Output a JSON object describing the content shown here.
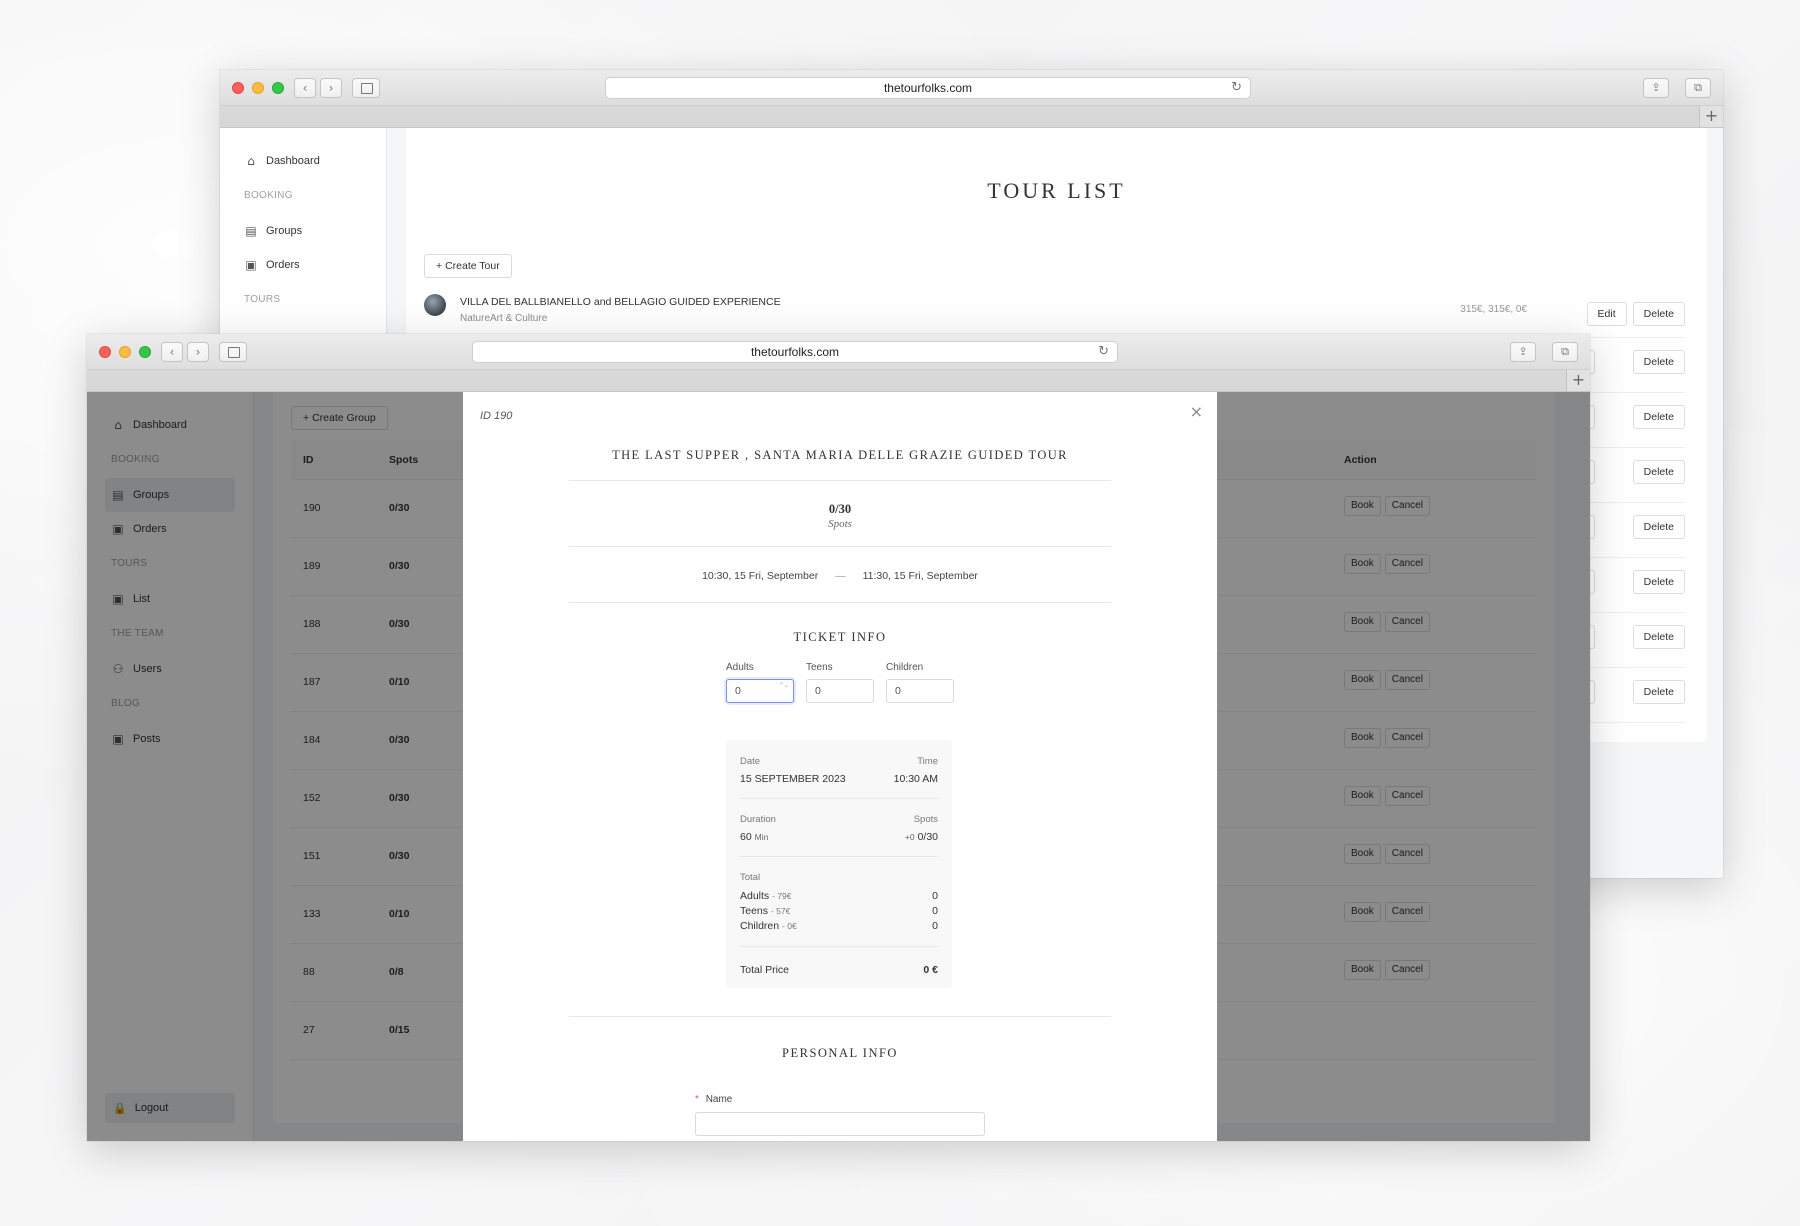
{
  "url": "thetourfolks.com",
  "icons": {
    "dashboard": "⌂",
    "groups": "▤",
    "orders": "▣",
    "list": "▣",
    "users": "⚇",
    "posts": "▣",
    "logout": "🔒",
    "plus": "+",
    "close": "×",
    "reload": "↻",
    "back": "‹",
    "forward": "›",
    "share": "⇪",
    "tabs": "⧉"
  },
  "back_window": {
    "sidebar": {
      "dashboard": "Dashboard",
      "booking_head": "BOOKING",
      "groups": "Groups",
      "orders": "Orders",
      "tours_head": "TOURS"
    },
    "title": "TOUR LIST",
    "create_tour": "Create Tour",
    "tour": {
      "name": "VILLA DEL BALLBIANELLO and BELLAGIO GUIDED EXPERIENCE",
      "category": "NatureArt & Culture",
      "price": "315€, 315€, 0€"
    },
    "edit": "Edit",
    "delete": "Delete",
    "extra_rows": 7
  },
  "front_window": {
    "sidebar": {
      "dashboard": "Dashboard",
      "booking_head": "BOOKING",
      "groups": "Groups",
      "orders": "Orders",
      "tours_head": "TOURS",
      "list": "List",
      "team_head": "THE TEAM",
      "users": "Users",
      "blog_head": "BLOG",
      "posts": "Posts",
      "logout": "Logout"
    },
    "create_group": "Create Group",
    "table_headers": {
      "id": "ID",
      "spots": "Spots",
      "action": "Action"
    },
    "rows": [
      {
        "id": "190",
        "spots": "0/30"
      },
      {
        "id": "189",
        "spots": "0/30"
      },
      {
        "id": "188",
        "spots": "0/30"
      },
      {
        "id": "187",
        "spots": "0/10"
      },
      {
        "id": "184",
        "spots": "0/30"
      },
      {
        "id": "152",
        "spots": "0/30"
      },
      {
        "id": "151",
        "spots": "0/30"
      },
      {
        "id": "133",
        "spots": "0/10"
      },
      {
        "id": "88",
        "spots": "0/8"
      },
      {
        "id": "27",
        "spots": "0/15"
      }
    ],
    "book": "Book",
    "cancel": "Cancel"
  },
  "modal": {
    "id_label": "ID 190",
    "title": "THE LAST SUPPER , SANTA MARIA DELLE GRAZIE GUIDED TOUR",
    "spots_value": "0/30",
    "spots_label": "Spots",
    "start": "10:30, 15 Fri, September",
    "dash": "—",
    "end": "11:30, 15 Fri, September",
    "ticket_info": "TICKET INFO",
    "adults_label": "Adults",
    "teens_label": "Teens",
    "children_label": "Children",
    "adults_value": "0",
    "teens_value": "0",
    "children_value": "0",
    "spin": "⌃⌄",
    "summary": {
      "date_label": "Date",
      "date_value": "15 SEPTEMBER 2023",
      "time_label": "Time",
      "time_value": "10:30 AM",
      "duration_label": "Duration",
      "duration_value": "60",
      "duration_unit": "Min",
      "spots_label": "Spots",
      "spots_delta": "+0",
      "spots_value": "0/30",
      "total_label": "Total",
      "adults": "Adults",
      "adults_price": "- 79€",
      "adults_total": "0",
      "teens": "Teens",
      "teens_price": "- 57€",
      "teens_total": "0",
      "children": "Children",
      "children_price": "- 0€",
      "children_total": "0",
      "total_price_label": "Total Price",
      "total_price": "0 €"
    },
    "personal_info": "PERSONAL INFO",
    "name_required": "*",
    "name_label": "Name"
  },
  "colors": {
    "focus": "#7b8cf2",
    "required": "#e0556b",
    "overlay": "rgba(0,0,0,0.45)"
  }
}
